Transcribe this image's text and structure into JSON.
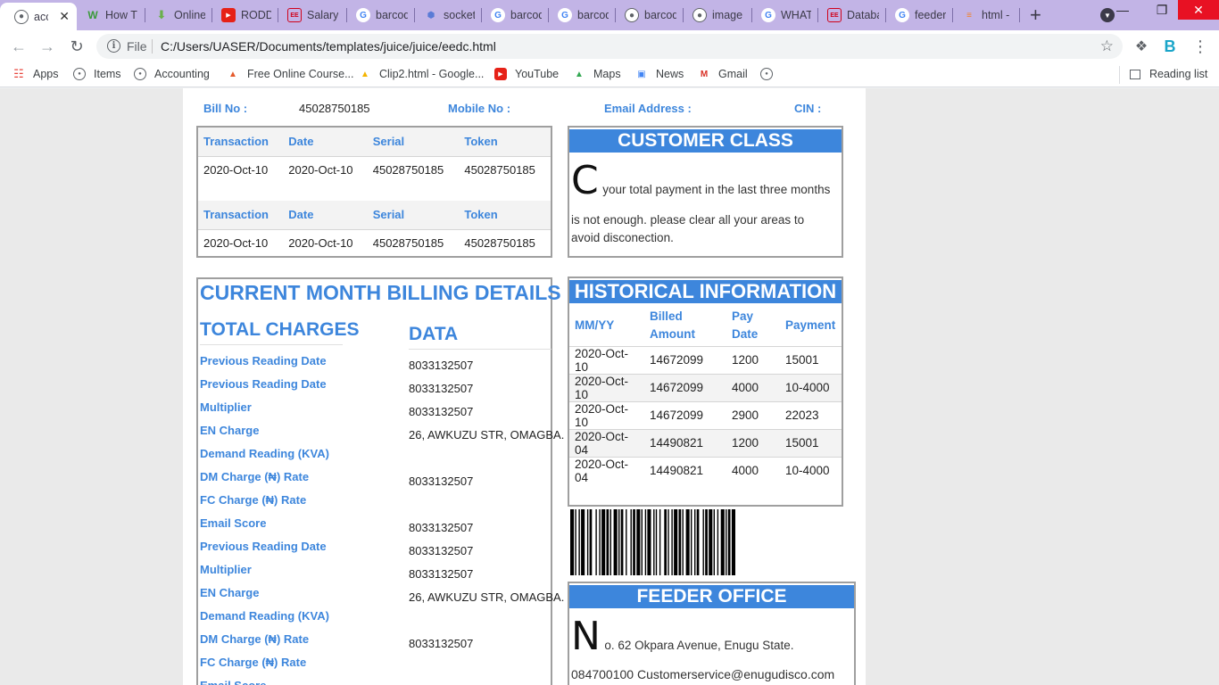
{
  "browser": {
    "tabs": [
      {
        "title": "acc",
        "favicon": "globe-icon"
      },
      {
        "title": "How T",
        "favicon": "wikihow-icon"
      },
      {
        "title": "Online",
        "favicon": "download-icon"
      },
      {
        "title": "RODD",
        "favicon": "youtube-icon"
      },
      {
        "title": "Salary",
        "favicon": "eedc-icon"
      },
      {
        "title": "barcod",
        "favicon": "google-icon"
      },
      {
        "title": "socket",
        "favicon": "socketio-icon"
      },
      {
        "title": "barcod",
        "favicon": "google-icon"
      },
      {
        "title": "barcod",
        "favicon": "google-icon"
      },
      {
        "title": "barcod",
        "favicon": "globe-icon"
      },
      {
        "title": "image",
        "favicon": "globe-icon"
      },
      {
        "title": "WHAT",
        "favicon": "google-icon"
      },
      {
        "title": "Databa",
        "favicon": "eedc-icon"
      },
      {
        "title": "feeder",
        "favicon": "google-icon"
      },
      {
        "title": "html -",
        "favicon": "stackoverflow-icon"
      }
    ],
    "address": {
      "scheme_label": "File",
      "url": "C:/Users/UASER/Documents/templates/juice/juice/eedc.html"
    },
    "bookmarks": [
      {
        "label": "Apps",
        "icon": "apps-grid-icon"
      },
      {
        "label": "Items",
        "icon": "globe-icon"
      },
      {
        "label": "Accounting",
        "icon": "globe-icon"
      },
      {
        "label": "Free Online Course...",
        "icon": "alison-icon"
      },
      {
        "label": "Clip2.html - Google...",
        "icon": "drive-icon"
      },
      {
        "label": "YouTube",
        "icon": "youtube-icon"
      },
      {
        "label": "Maps",
        "icon": "maps-icon"
      },
      {
        "label": "News",
        "icon": "news-icon"
      },
      {
        "label": "Gmail",
        "icon": "gmail-icon"
      },
      {
        "label": "",
        "icon": "globe-icon"
      }
    ],
    "reading_list": "Reading list"
  },
  "page": {
    "header": {
      "bill_no_label": "Bill No :",
      "bill_no": "45028750185",
      "mobile_label": "Mobile No :",
      "email_label": "Email Address :",
      "cin_label": "CIN :"
    },
    "transactions": {
      "headers": [
        "Transaction",
        "Date",
        "Serial",
        "Token"
      ],
      "rows": [
        [
          "2020-Oct-10",
          "2020-Oct-10",
          "45028750185",
          "45028750185"
        ]
      ]
    },
    "customer_class": {
      "title": "CUSTOMER CLASS",
      "letter": "C",
      "line1": "your total payment in the last three months",
      "line2": "is not enough. please clear all your areas to avoid disconection."
    },
    "billing": {
      "title": "CURRENT MONTH BILLING DETAILS",
      "col1": "TOTAL CHARGES",
      "col2": "DATA",
      "rows": [
        {
          "label": "Previous Reading Date",
          "value": "8033132507"
        },
        {
          "label": "Previous Reading Date",
          "value": "8033132507"
        },
        {
          "label": "Multiplier",
          "value": "8033132507"
        },
        {
          "label": "EN Charge",
          "value": "26, AWKUZU STR, OMAGBA."
        },
        {
          "label": "Demand Reading (KVA)",
          "value": ""
        },
        {
          "label": "DM Charge (₦) Rate",
          "value": "8033132507"
        },
        {
          "label": "FC Charge (₦) Rate",
          "value": ""
        },
        {
          "label": "Email Score",
          "value": "8033132507"
        },
        {
          "label": "Previous Reading Date",
          "value": "8033132507"
        },
        {
          "label": "Multiplier",
          "value": "8033132507"
        },
        {
          "label": "EN Charge",
          "value": "26, AWKUZU STR, OMAGBA."
        },
        {
          "label": "Demand Reading (KVA)",
          "value": ""
        },
        {
          "label": "DM Charge (₦) Rate",
          "value": "8033132507"
        },
        {
          "label": "FC Charge (₦) Rate",
          "value": ""
        },
        {
          "label": "Email Score",
          "value": ""
        }
      ]
    },
    "history": {
      "title": "HISTORICAL INFORMATION",
      "headers": [
        "MM/YY",
        "Billed Amount",
        "Pay Date",
        "Payment"
      ],
      "rows": [
        [
          "2020-Oct-10",
          "14672099",
          "1200",
          "15001"
        ],
        [
          "2020-Oct-10",
          "14672099",
          "4000",
          "10-4000"
        ],
        [
          "2020-Oct-10",
          "14672099",
          "2900",
          "22023"
        ],
        [
          "2020-Oct-04",
          "14490821",
          "1200",
          "15001"
        ],
        [
          "2020-Oct-04",
          "14490821",
          "4000",
          "10-4000"
        ]
      ]
    },
    "feeder": {
      "title": "FEEDER OFFICE",
      "letter": "N",
      "address": "o. 62 Okpara Avenue, Enugu State.",
      "contact": "084700100 Customerservice@enugudisco.com"
    }
  }
}
